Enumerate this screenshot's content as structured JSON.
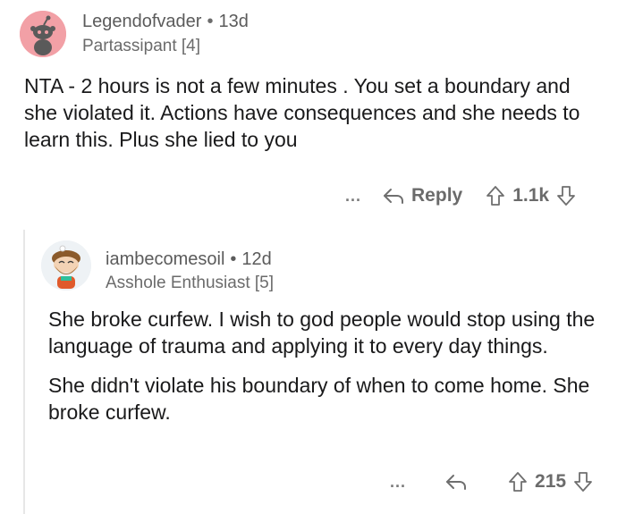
{
  "comments": [
    {
      "username": "Legendofvader",
      "age": "13d",
      "flair": "Partassipant [4]",
      "body": "NTA  - 2 hours is not a few minutes . You set a boundary and she violated it. Actions have consequences and she needs to learn this. Plus she lied to you",
      "more_label": "...",
      "reply_label": "Reply",
      "score": "1.1k",
      "avatar_color": "#f2a0a6"
    },
    {
      "username": "iambecomesoil",
      "age": "12d",
      "flair": "Asshole Enthusiast [5]",
      "body_paragraphs": [
        "She broke curfew.  I wish to god people would stop using the language of trauma and applying it to every day things.",
        "She didn't violate his boundary of when to come home.  She broke curfew."
      ],
      "more_label": "...",
      "score": "215"
    }
  ],
  "separator": "•",
  "icons": {
    "more": "more-icon",
    "reply": "reply-arrow-icon",
    "upvote": "upvote-arrow-icon",
    "downvote": "downvote-arrow-icon"
  }
}
